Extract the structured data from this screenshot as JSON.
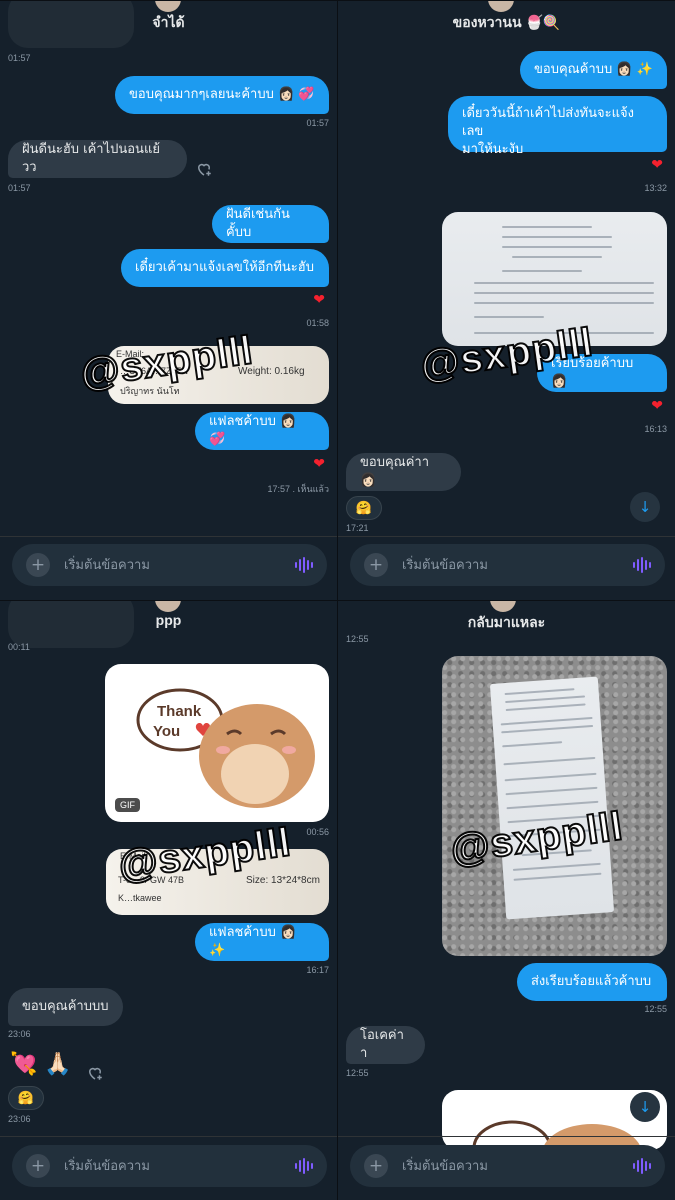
{
  "panels": [
    {
      "contact_name": "จำได้",
      "messages": {
        "t0": "01:57",
        "m1": "ขอบคุณมากๆเลยนะค้าบบ 👩🏻 💞",
        "t1": "01:57",
        "m2": "ฝันดีนะฮับ เค้าไปนอนแย้วว",
        "t2": "01:57",
        "m3": "ฝันดีเช่นกันคั้บบ",
        "m4": "เดี๋ยวเค้ามาแจ้งเลขให้อีกทีนะฮับ",
        "t3": "01:58",
        "pkg_email": "E-Mail:",
        "pkg_tracking": "…UT6A…7Z45N",
        "pkg_weight": "Weight: 0.16kg",
        "pkg_name": "ปริญาทร นันโท",
        "m5": "แฟลชค้าบบ 👩🏻 💞",
        "t4": "17:57 . เห็นแล้ว"
      }
    },
    {
      "contact_name": "ของหวานน 🍧🍭",
      "messages": {
        "m1": "ขอบคุณค้าบบ 👩🏻 ✨",
        "m2_line1": "เดี๋ยววันนี้ถ้าเค้าไปส่งทันจะแจ้งเลข",
        "m2_line2": "มาให้นะงับ",
        "t1": "13:32",
        "m3": "เรียบร้อยค้าบบ 👩🏻",
        "t2": "16:13",
        "m4": "ขอบคุณค่าา 👩🏻",
        "t3": "17:21",
        "reaction": "🤗"
      }
    },
    {
      "contact_name": "ppp",
      "messages": {
        "t0": "00:11",
        "gif_label": "GIF",
        "sticker_text": "Thank You",
        "t1": "00:56",
        "pkg_email": "E-Mail:",
        "pkg_tracking": "T-0…9/ GW 47B",
        "pkg_size": "Size: 13*24*8cm",
        "pkg_name": "K…tkawee",
        "m1": "แฟลชค้าบบ 👩🏻 ✨",
        "t2": "16:17",
        "m2": "ขอบคุณค้าบบบ",
        "t3": "23:06",
        "emoji": "💘 🙏🏻",
        "reaction": "🤗",
        "t4": "23:06"
      }
    },
    {
      "contact_name": "กลับมาแหละ",
      "messages": {
        "t0": "12:55",
        "m1": "ส่งเรียบร้อยแล้วค้าบบ",
        "t1": "12:55",
        "m2": "โอเคค่าา",
        "t2": "12:55"
      }
    }
  ],
  "watermark": "@sxpplll",
  "composer": {
    "placeholder": "เริ่มต้นข้อความ",
    "plus": "+"
  },
  "icons": {
    "scroll_down": "↓",
    "heart": "❤"
  },
  "colors": {
    "accent": "#1d9bf0",
    "incoming": "#2f3b47",
    "background": "#15202b",
    "heart": "#f4212e"
  }
}
